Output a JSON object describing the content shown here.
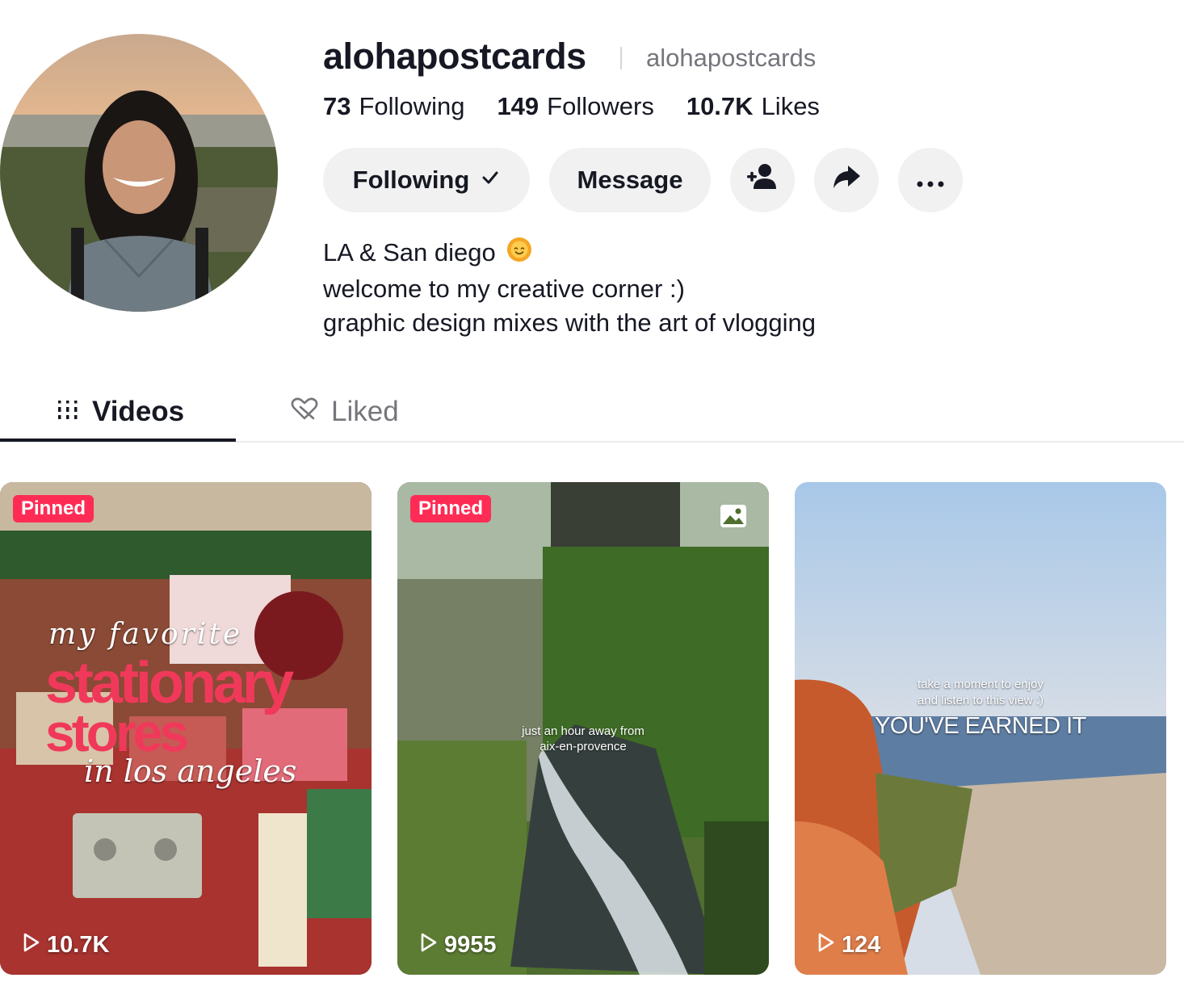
{
  "profile": {
    "username": "alohapostcards",
    "nickname": "alohapostcards"
  },
  "stats": {
    "following_count": "73",
    "following_label": "Following",
    "followers_count": "149",
    "followers_label": "Followers",
    "likes_count": "10.7K",
    "likes_label": "Likes"
  },
  "actions": {
    "following_label": "Following",
    "message_label": "Message"
  },
  "bio": {
    "line1": "LA & San diego",
    "line2": "welcome to my creative corner :)",
    "line3": "graphic design mixes with the art of vlogging"
  },
  "tabs": {
    "videos": "Videos",
    "liked": "Liked"
  },
  "videos": [
    {
      "pinned_label": "Pinned",
      "views": "10.7K",
      "overlay": [
        "my favorite",
        "stationary",
        "stores",
        "in los angeles"
      ]
    },
    {
      "pinned_label": "Pinned",
      "views": "9955",
      "overlay": [
        "just an hour away from",
        "aix-en-provence"
      ]
    },
    {
      "views": "124",
      "overlay": [
        "take a moment to enjoy",
        "and listen to this view :)",
        "YOU'VE EARNED IT"
      ]
    }
  ],
  "colors": {
    "accent": "#fe2c55",
    "text": "#161823",
    "muted": "#75767c",
    "button_bg": "#f1f1f2"
  }
}
